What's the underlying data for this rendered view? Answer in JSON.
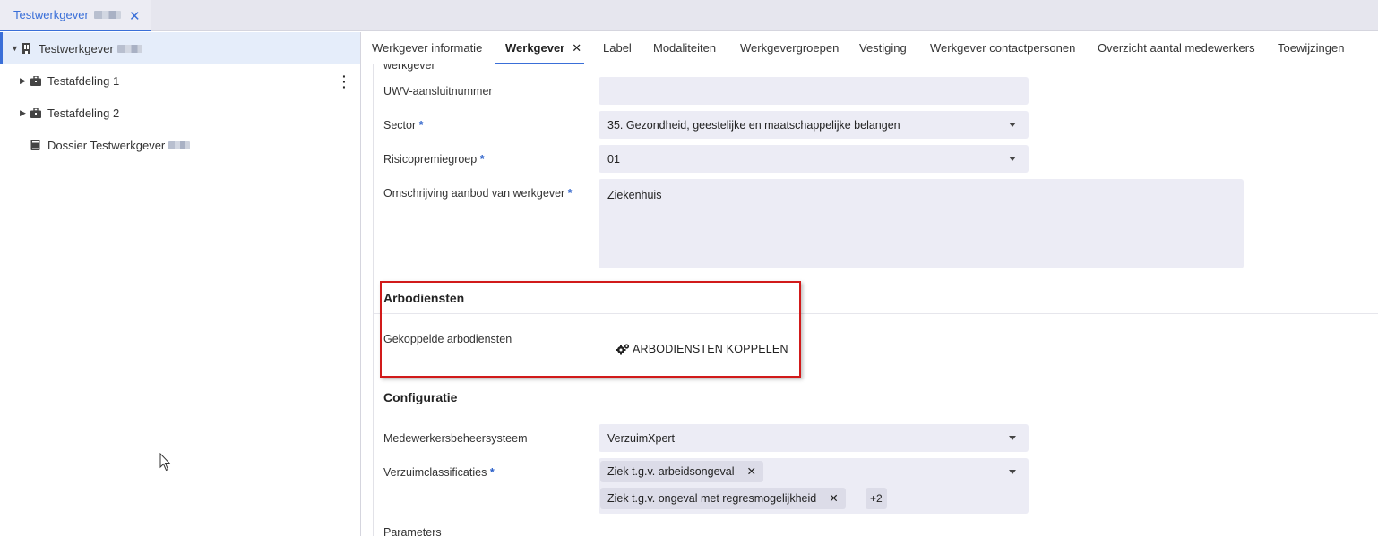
{
  "top_tab": {
    "title": "Testwerkgever",
    "close": "✕"
  },
  "tree": {
    "root": "Testwerkgever",
    "items": [
      {
        "label": "Testafdeling 1"
      },
      {
        "label": "Testafdeling 2"
      },
      {
        "label": "Dossier Testwerkgever"
      }
    ]
  },
  "tabs": [
    {
      "label": "Werkgever informatie"
    },
    {
      "label": "Werkgever",
      "close": "✕"
    },
    {
      "label": "Label"
    },
    {
      "label": "Modaliteiten"
    },
    {
      "label": "Werkgevergroepen"
    },
    {
      "label": "Vestiging"
    },
    {
      "label": "Werkgever contactpersonen"
    },
    {
      "label": "Overzicht aantal medewerkers"
    },
    {
      "label": "Toewijzingen"
    }
  ],
  "form": {
    "cut_label": "werkgever",
    "uwv": {
      "label": "UWV-aansluitnummer",
      "value": ""
    },
    "sector": {
      "label": "Sector",
      "required": "*",
      "value": "35. Gezondheid, geestelijke en maatschappelijke belangen"
    },
    "risico": {
      "label": "Risicopremiegroep",
      "required": "*",
      "value": "01"
    },
    "omschrijving": {
      "label": "Omschrijving aanbod van werkgever",
      "required": "*",
      "value": "Ziekenhuis"
    }
  },
  "arbo": {
    "title": "Arbodiensten",
    "label": "Gekoppelde arbodiensten",
    "button": "ARBODIENSTEN KOPPELEN"
  },
  "config": {
    "title": "Configuratie",
    "mbs": {
      "label": "Medewerkersbeheersysteem",
      "value": "VerzuimXpert"
    },
    "verzuim": {
      "label": "Verzuimclassificaties",
      "required": "*",
      "chips": [
        "Ziek t.g.v. arbeidsongeval",
        "Ziek t.g.v. ongeval met regresmogelijkheid"
      ],
      "more": "+2",
      "chip_close": "✕"
    },
    "parameters": "Parameters"
  },
  "colors": {
    "accent": "#3a6fd8",
    "highlight": "#d11a1a",
    "field_bg": "#ececf5"
  }
}
